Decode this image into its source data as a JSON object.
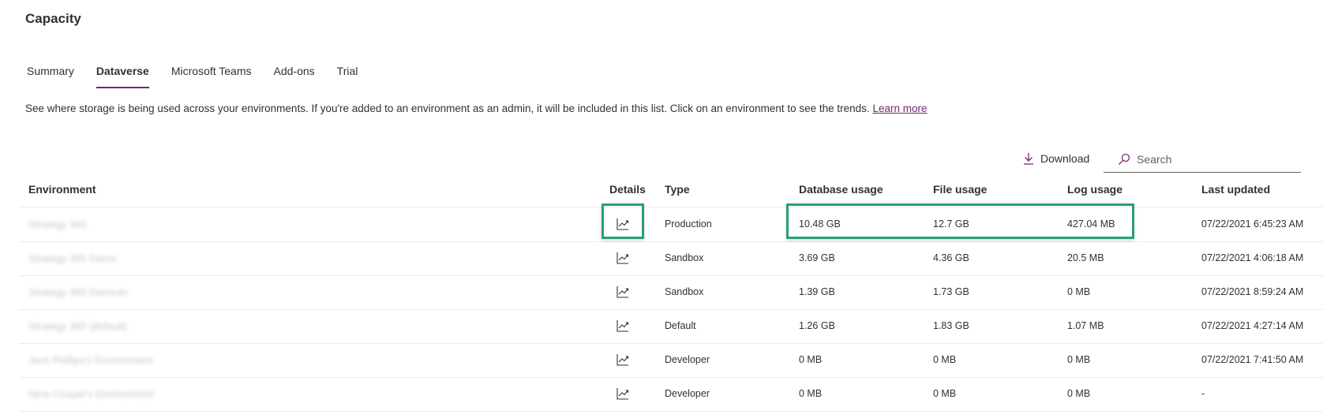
{
  "page": {
    "title": "Capacity"
  },
  "tabs": [
    {
      "label": "Summary",
      "active": false
    },
    {
      "label": "Dataverse",
      "active": true
    },
    {
      "label": "Microsoft Teams",
      "active": false
    },
    {
      "label": "Add-ons",
      "active": false
    },
    {
      "label": "Trial",
      "active": false
    }
  ],
  "description": {
    "text": "See where storage is being used across your environments. If you're added to an environment as an admin, it will be included in this list. Click on an environment to see the trends.",
    "link": "Learn more"
  },
  "toolbar": {
    "download_label": "Download",
    "search_placeholder": "Search"
  },
  "table": {
    "columns": {
      "environment": "Environment",
      "details": "Details",
      "type": "Type",
      "database": "Database usage",
      "file": "File usage",
      "log": "Log usage",
      "updated": "Last updated"
    },
    "rows": [
      {
        "environment": "Strategy 365",
        "type": "Production",
        "database": "10.48 GB",
        "file": "12.7 GB",
        "log": "427.04 MB",
        "updated": "07/22/2021 6:45:23 AM"
      },
      {
        "environment": "Strategy 365 Demo",
        "type": "Sandbox",
        "database": "3.69 GB",
        "file": "4.36 GB",
        "log": "20.5 MB",
        "updated": "07/22/2021 4:06:18 AM"
      },
      {
        "environment": "Strategy 365 Demo4x",
        "type": "Sandbox",
        "database": "1.39 GB",
        "file": "1.73 GB",
        "log": "0 MB",
        "updated": "07/22/2021 8:59:24 AM"
      },
      {
        "environment": "Strategy 365 (default)",
        "type": "Default",
        "database": "1.26 GB",
        "file": "1.83 GB",
        "log": "1.07 MB",
        "updated": "07/22/2021 4:27:14 AM"
      },
      {
        "environment": "Jack Phillips's Environment",
        "type": "Developer",
        "database": "0 MB",
        "file": "0 MB",
        "log": "0 MB",
        "updated": "07/22/2021 7:41:50 AM"
      },
      {
        "environment": "Nina Cooper's Environment",
        "type": "Developer",
        "database": "0 MB",
        "file": "0 MB",
        "log": "0 MB",
        "updated": "-"
      }
    ]
  },
  "colors": {
    "accent": "#742774",
    "highlight": "#2a9d7c"
  },
  "icons": {
    "details": "trend-chart-icon",
    "download": "download-icon",
    "search": "search-icon"
  }
}
